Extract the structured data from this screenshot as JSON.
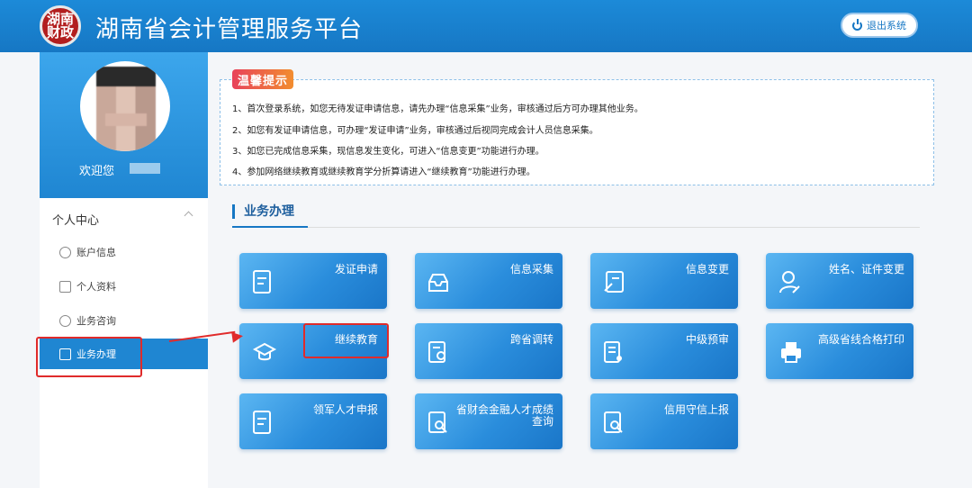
{
  "header": {
    "logo_text": "湖南财政",
    "title": "湖南省会计管理服务平台",
    "logout_label": "退出系统"
  },
  "sidebar": {
    "welcome": "欢迎您",
    "section": "个人中心",
    "items": [
      {
        "label": "账户信息",
        "icon": "user-icon"
      },
      {
        "label": "个人资料",
        "icon": "profile-icon"
      },
      {
        "label": "业务咨询",
        "icon": "phone-icon"
      },
      {
        "label": "业务办理",
        "icon": "briefcase-icon",
        "active": true
      }
    ]
  },
  "notice": {
    "badge": "温馨提示",
    "lines": [
      "1、首次登录系统，如您无待发证申请信息，请先办理“信息采集”业务，审核通过后方可办理其他业务。",
      "2、如您有发证申请信息，可办理“发证申请”业务，审核通过后视同完成会计人员信息采集。",
      "3、如您已完成信息采集，现信息发生变化，可进入“信息变更”功能进行办理。",
      "4、参加网络继续教育或继续教育学分折算请进入“继续教育”功能进行办理。"
    ]
  },
  "business": {
    "title": "业务办理",
    "tiles": [
      {
        "label": "发证申请",
        "icon": "certificate-icon"
      },
      {
        "label": "信息采集",
        "icon": "inbox-icon"
      },
      {
        "label": "信息变更",
        "icon": "edit-doc-icon"
      },
      {
        "label": "姓名、证件变更",
        "icon": "user-edit-icon"
      },
      {
        "label": "继续教育",
        "icon": "graduation-cap-icon"
      },
      {
        "label": "跨省调转",
        "icon": "transfer-icon"
      },
      {
        "label": "中级预审",
        "icon": "review-icon"
      },
      {
        "label": "高级省线合格打印",
        "icon": "printer-icon"
      },
      {
        "label": "领军人才申报",
        "icon": "certificate-icon"
      },
      {
        "label": "省财会金融人才成绩查询",
        "icon": "search-doc-icon"
      },
      {
        "label": "信用守信上报",
        "icon": "search-doc-icon"
      }
    ]
  },
  "colors": {
    "primary": "#1677c4",
    "tile": "#2a8ddc",
    "highlight": "#e02b2b"
  }
}
